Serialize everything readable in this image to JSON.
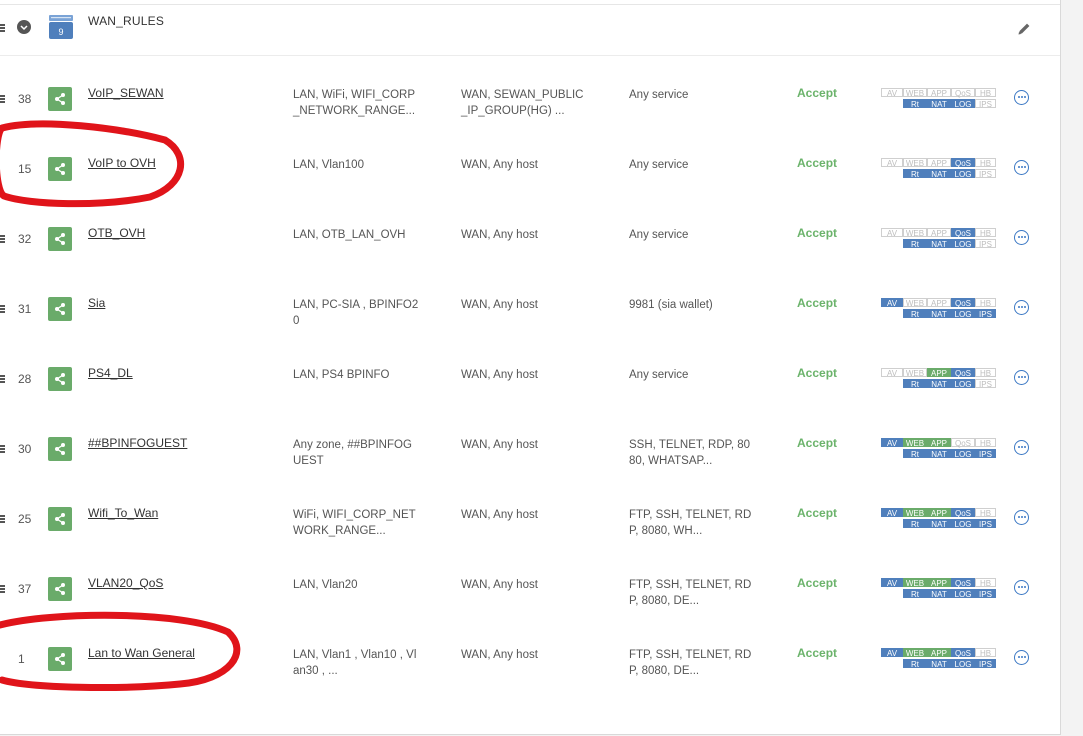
{
  "group": {
    "title": "WAN_RULES",
    "icon": "rule-group-icon",
    "edit_icon": "pencil-icon",
    "collapse_icon": "chevron-down-icon"
  },
  "rules": [
    {
      "num": "38",
      "name": "VoIP_SEWAN",
      "source": "LAN, WiFi, WIFI_CORP _NETWORK_RANGE...",
      "destination": "WAN, SEWAN_PUBLIC _IP_GROUP(HG) ...",
      "service": "Any service",
      "action": "Accept",
      "has_drag": true,
      "flags": {
        "AV": false,
        "WEB": false,
        "APP": false,
        "QoS": false,
        "HB": false,
        "Rt": true,
        "NAT": true,
        "LOG": true,
        "IPS": false
      }
    },
    {
      "num": "15",
      "name": "VoIP to OVH",
      "source": "LAN, Vlan100",
      "destination": "WAN, Any host",
      "service": "Any service",
      "action": "Accept",
      "has_drag": false,
      "flags": {
        "AV": false,
        "WEB": false,
        "APP": false,
        "QoS": true,
        "HB": false,
        "Rt": true,
        "NAT": true,
        "LOG": true,
        "IPS": false
      }
    },
    {
      "num": "32",
      "name": "OTB_OVH",
      "source": "LAN, OTB_LAN_OVH",
      "destination": "WAN, Any host",
      "service": "Any service",
      "action": "Accept",
      "has_drag": true,
      "flags": {
        "AV": false,
        "WEB": false,
        "APP": false,
        "QoS": true,
        "HB": false,
        "Rt": true,
        "NAT": true,
        "LOG": true,
        "IPS": false
      }
    },
    {
      "num": "31",
      "name": "Sia",
      "source": "LAN, PC-SIA , BPINFO2 0",
      "destination": "WAN, Any host",
      "service": "9981 (sia wallet)",
      "action": "Accept",
      "has_drag": true,
      "flags": {
        "AV": true,
        "WEB": false,
        "APP": false,
        "QoS": true,
        "HB": false,
        "Rt": true,
        "NAT": true,
        "LOG": true,
        "IPS": true
      }
    },
    {
      "num": "28",
      "name": "PS4_DL",
      "source": "LAN, PS4 BPINFO",
      "destination": "WAN, Any host",
      "service": "Any service",
      "action": "Accept",
      "has_drag": true,
      "flags": {
        "AV": false,
        "WEB": false,
        "APP": true,
        "QoS": true,
        "HB": false,
        "Rt": true,
        "NAT": true,
        "LOG": true,
        "IPS": false
      }
    },
    {
      "num": "30",
      "name": "##BPINFOGUEST",
      "source": "Any zone, ##BPINFOG UEST",
      "destination": "WAN, Any host",
      "service": "SSH, TELNET, RDP, 80 80, WHATSAP...",
      "action": "Accept",
      "has_drag": true,
      "flags": {
        "AV": true,
        "WEB": true,
        "APP": true,
        "QoS": false,
        "HB": false,
        "Rt": true,
        "NAT": true,
        "LOG": true,
        "IPS": true
      }
    },
    {
      "num": "25",
      "name": "Wifi_To_Wan",
      "source": "WiFi, WIFI_CORP_NET WORK_RANGE...",
      "destination": "WAN, Any host",
      "service": "FTP, SSH, TELNET, RD P, 8080, WH...",
      "action": "Accept",
      "has_drag": true,
      "flags": {
        "AV": true,
        "WEB": true,
        "APP": true,
        "QoS": true,
        "HB": false,
        "Rt": true,
        "NAT": true,
        "LOG": true,
        "IPS": true
      }
    },
    {
      "num": "37",
      "name": "VLAN20_QoS",
      "source": "LAN, Vlan20",
      "destination": "WAN, Any host",
      "service": "FTP, SSH, TELNET, RD P, 8080, DE...",
      "action": "Accept",
      "has_drag": true,
      "flags": {
        "AV": true,
        "WEB": true,
        "APP": true,
        "QoS": true,
        "HB": false,
        "Rt": true,
        "NAT": true,
        "LOG": true,
        "IPS": true
      }
    },
    {
      "num": "1",
      "name": "Lan to Wan General",
      "source": "LAN, Vlan1 , Vlan10 , Vl an30 , ...",
      "destination": "WAN, Any host",
      "service": "FTP, SSH, TELNET, RD P, 8080, DE...",
      "action": "Accept",
      "has_drag": false,
      "flags": {
        "AV": true,
        "WEB": true,
        "APP": true,
        "QoS": true,
        "HB": false,
        "Rt": true,
        "NAT": true,
        "LOG": true,
        "IPS": true
      }
    }
  ],
  "badge_labels_top": [
    "AV",
    "WEB",
    "APP",
    "QoS",
    "HB"
  ],
  "badge_labels_bottom": [
    "Rt",
    "NAT",
    "LOG",
    "IPS"
  ],
  "colors": {
    "accept": "#6bb36b",
    "badge_on": "#4f7fbc",
    "badge_app_on": "#6aab6a",
    "rule_icon": "#6aab6a",
    "annotation": "#e0141a"
  },
  "icons": {
    "rule": "share-rule-icon",
    "more": "more-options-icon",
    "drag": "drag-handle-icon"
  }
}
